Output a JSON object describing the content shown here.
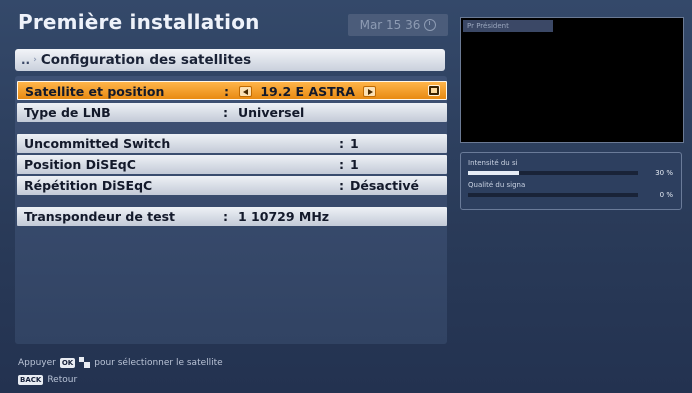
{
  "header": {
    "title": "Première installation",
    "datetime": "Mar 15 36"
  },
  "section": {
    "crumb": "..",
    "title": "Configuration des satellites"
  },
  "rows": [
    {
      "label": "Satellite et position",
      "colon": ":",
      "value": "19.2 E ASTRA"
    },
    {
      "label": "Type de LNB",
      "colon": ":",
      "value": "Universel"
    },
    {
      "label": "Uncommitted Switch",
      "colon": ":",
      "value": "1"
    },
    {
      "label": "Position DiSEqC",
      "colon": ":",
      "value": "1"
    },
    {
      "label": "Répétition DiSEqC",
      "colon": ":",
      "value": "Désactivé"
    },
    {
      "label": "Transpondeur de test",
      "colon": ":",
      "value": "1 10729 MHz"
    }
  ],
  "preview": {
    "label": "Pr Président"
  },
  "signal": {
    "strength_label": "Intensité du si",
    "strength_value": "30 %",
    "strength_level": 0.3,
    "quality_label": "Qualité du signa",
    "quality_value": "0 %",
    "quality_level": 0
  },
  "footer": {
    "prefix": "Appuyer",
    "ok_key": "OK",
    "instruction": "pour sélectionner le satellite",
    "back_key": "BACK",
    "back_label": "Retour"
  }
}
